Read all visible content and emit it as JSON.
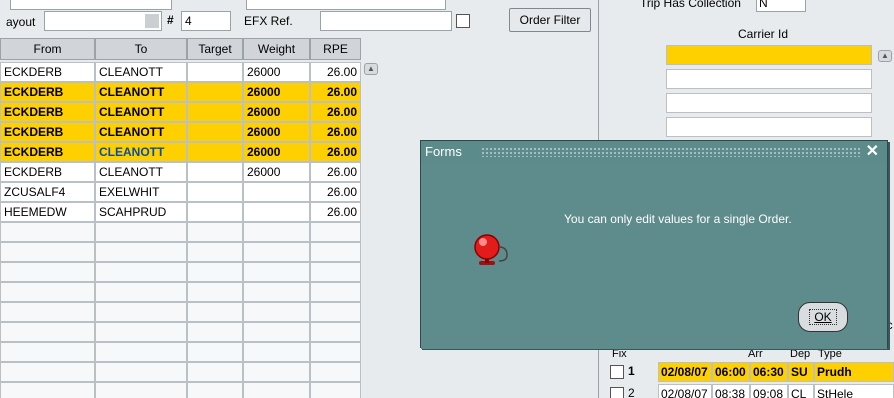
{
  "toolbar": {
    "layout_label": "ayout",
    "hash_label": "#",
    "hash_value": "4",
    "efx_label": "EFX Ref.",
    "order_filter_label": "Order Filter",
    "trip_collection_label": "Trip Has Collection",
    "trip_collection_value": "N"
  },
  "grid": {
    "columns": [
      "From",
      "To",
      "Target",
      "Weight",
      "RPE"
    ],
    "rows": [
      {
        "from": "ECKDERB",
        "to": "CLEANOTT",
        "target": "",
        "weight": "26000",
        "rpe": "26.00",
        "selected": false
      },
      {
        "from": "ECKDERB",
        "to": "CLEANOTT",
        "target": "",
        "weight": "26000",
        "rpe": "26.00",
        "selected": true
      },
      {
        "from": "ECKDERB",
        "to": "CLEANOTT",
        "target": "",
        "weight": "26000",
        "rpe": "26.00",
        "selected": true
      },
      {
        "from": "ECKDERB",
        "to": "CLEANOTT",
        "target": "",
        "weight": "26000",
        "rpe": "26.00",
        "selected": true
      },
      {
        "from": "ECKDERB",
        "to": "CLEANOTT",
        "target": "",
        "weight": "26000",
        "rpe": "26.00",
        "selected": true
      },
      {
        "from": "ECKDERB",
        "to": "CLEANOTT",
        "target": "",
        "weight": "26000",
        "rpe": "26.00",
        "selected": false
      },
      {
        "from": "ZCUSALF4",
        "to": "EXELWHIT",
        "target": "",
        "weight": "",
        "rpe": "26.00",
        "selected": false
      },
      {
        "from": "HEEMEDW",
        "to": "SCAHPRUD",
        "target": "",
        "weight": "",
        "rpe": "26.00",
        "selected": false
      }
    ]
  },
  "carrier": {
    "label": "Carrier Id"
  },
  "trips": {
    "headers": [
      "Fix",
      "Arr",
      "Dep",
      "Type"
    ],
    "rows": [
      {
        "no": "1",
        "date": "02/08/07",
        "arr": "06:00",
        "dep": "06:30",
        "type": "SU",
        "place": "Prudh",
        "selected": true
      },
      {
        "no": "2",
        "date": "02/08/07",
        "arr": "08:38",
        "dep": "09:08",
        "type": "CL",
        "place": "StHele",
        "selected": false
      }
    ],
    "side_label": "uc"
  },
  "dialog": {
    "title": "Forms",
    "message": "You can only edit values for a single Order.",
    "ok_label": "OK",
    "close_glyph": "✕"
  }
}
